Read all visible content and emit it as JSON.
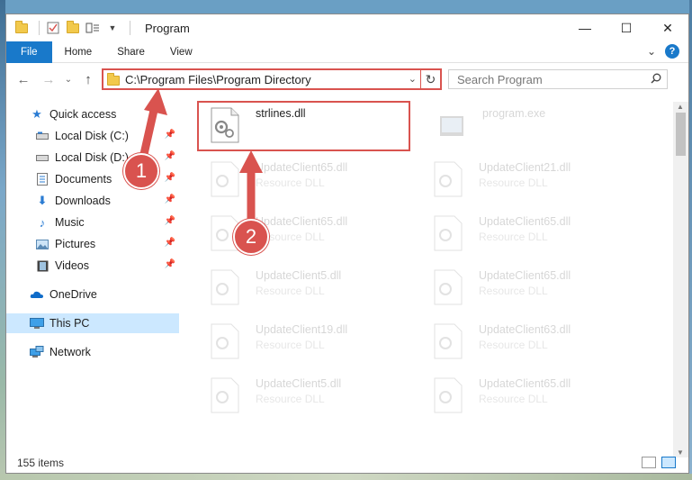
{
  "window": {
    "title": "Program",
    "controls": {
      "minimize": "—",
      "maximize": "☐",
      "close": "✕"
    }
  },
  "ribbon": {
    "tabs": [
      "File",
      "Home",
      "Share",
      "View"
    ],
    "expand": "⌄",
    "help": "?"
  },
  "nav": {
    "back": "←",
    "forward": "→",
    "recent": "⌄",
    "up": "↑",
    "address": "C:\\Program Files\\Program Directory",
    "address_dropdown": "⌄",
    "refresh": "↻",
    "search_placeholder": "Search Program"
  },
  "sidebar": {
    "items": [
      {
        "label": "Quick access",
        "icon": "star-icon",
        "pinned": false
      },
      {
        "label": "Local Disk (C:)",
        "icon": "drive-icon",
        "pinned": true
      },
      {
        "label": "Local Disk (D:)",
        "icon": "drive-icon",
        "pinned": true
      },
      {
        "label": "Documents",
        "icon": "documents-icon",
        "pinned": true
      },
      {
        "label": "Downloads",
        "icon": "downloads-icon",
        "pinned": true
      },
      {
        "label": "Music",
        "icon": "music-icon",
        "pinned": true
      },
      {
        "label": "Pictures",
        "icon": "pictures-icon",
        "pinned": true
      },
      {
        "label": "Videos",
        "icon": "videos-icon",
        "pinned": true
      },
      {
        "label": "OneDrive",
        "icon": "onedrive-icon",
        "pinned": false
      },
      {
        "label": "This PC",
        "icon": "pc-icon",
        "pinned": false,
        "selected": true
      },
      {
        "label": "Network",
        "icon": "network-icon",
        "pinned": false
      }
    ]
  },
  "files": [
    {
      "name": "strlines.dll",
      "type": "",
      "highlighted": true
    },
    {
      "name": "program.exe",
      "type": "",
      "faded": true
    },
    {
      "name": "UpdateClient65.dll",
      "type": "Resource DLL",
      "faded": true
    },
    {
      "name": "UpdateClient21.dll",
      "type": "Resource DLL",
      "faded": true
    },
    {
      "name": "UpdateClient65.dll",
      "type": "Resource DLL",
      "faded": true
    },
    {
      "name": "UpdateClient65.dll",
      "type": "Resource DLL",
      "faded": true
    },
    {
      "name": "UpdateClient5.dll",
      "type": "Resource DLL",
      "faded": true
    },
    {
      "name": "UpdateClient65.dll",
      "type": "Resource DLL",
      "faded": true
    },
    {
      "name": "UpdateClient19.dll",
      "type": "Resource DLL",
      "faded": true
    },
    {
      "name": "UpdateClient63.dll",
      "type": "Resource DLL",
      "faded": true
    },
    {
      "name": "UpdateClient5.dll",
      "type": "Resource DLL",
      "faded": true
    },
    {
      "name": "UpdateClient65.dll",
      "type": "Resource DLL",
      "faded": true
    }
  ],
  "status": {
    "item_count": "155 items"
  },
  "annotations": {
    "step1": "1",
    "step2": "2",
    "color": "#d9534f"
  }
}
